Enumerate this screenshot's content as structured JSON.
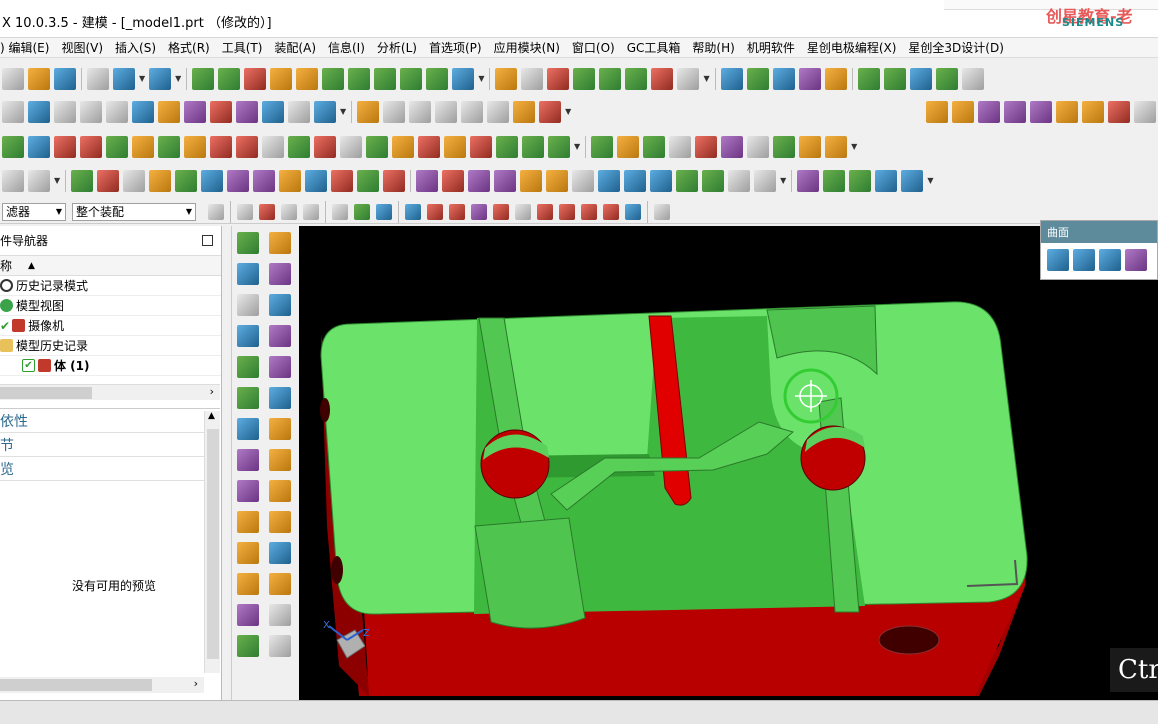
{
  "window": {
    "title": "X 10.0.3.5 - 建模 - [_model1.prt （修改的）]",
    "watermark": "创星教育-老",
    "brand": "SIEMENS"
  },
  "menubar": {
    "items": [
      ") 编辑(E)",
      "视图(V)",
      "插入(S)",
      "格式(R)",
      "工具(T)",
      "装配(A)",
      "信息(I)",
      "分析(L)",
      "首选项(P)",
      "应用模块(N)",
      "窗口(O)",
      "GC工具箱",
      "帮助(H)",
      "机明软件",
      "星创电极编程(X)",
      "星创全3D设计(D)"
    ]
  },
  "selection_bar": {
    "filter_label": "滤器",
    "scope_value": "整个装配"
  },
  "navigator": {
    "title": "件导航器",
    "column_name": "称",
    "rows": [
      {
        "label": "历史记录模式",
        "icon": "clock-icon"
      },
      {
        "label": "模型视图",
        "icon": "model-views-icon"
      },
      {
        "label": "摄像机",
        "icon": "camera-icon"
      },
      {
        "label": "模型历史记录",
        "icon": "folder-icon"
      },
      {
        "label": "体 (1)",
        "icon": "body-icon"
      }
    ],
    "dependencies_label": "依性",
    "details_label": "节",
    "preview_label": "览",
    "preview_empty": "没有可用的预览"
  },
  "surface_panel": {
    "title": "曲面"
  },
  "viewport": {
    "triad_z": "Z",
    "triad_x": "X",
    "overlay_text": "Ctr",
    "colors": {
      "background": "#000000",
      "top_face": "#6be36b",
      "side_face": "#c40000"
    }
  }
}
